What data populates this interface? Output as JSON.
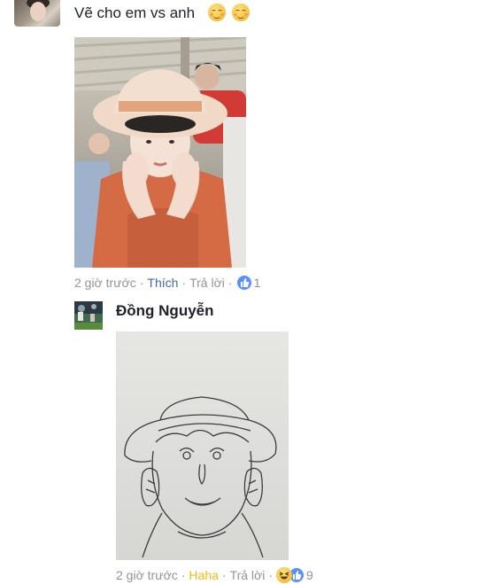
{
  "top_comment": {
    "text": "Vẽ cho em vs anh",
    "emojis": [
      "relieved-face",
      "relieved-face"
    ],
    "photo_alt": "selfie-photo",
    "time": "2 giờ trước",
    "like_label": "Thích",
    "reply_label": "Trả lời",
    "reactions": [
      "like"
    ],
    "reaction_count": "1"
  },
  "reply": {
    "author": "Đồng Nguyễn",
    "image": "pencil-sketch",
    "time": "2 giờ trước",
    "reaction_label": "Haha",
    "reply_label": "Trả lời",
    "reactions": [
      "haha",
      "like"
    ],
    "reaction_count": "9"
  },
  "colors": {
    "text": "#1d2129",
    "meta": "#90949c",
    "like_blue": "#4267b2",
    "haha_yellow": "#f0ba15",
    "badge_blue": "#5890ff"
  }
}
